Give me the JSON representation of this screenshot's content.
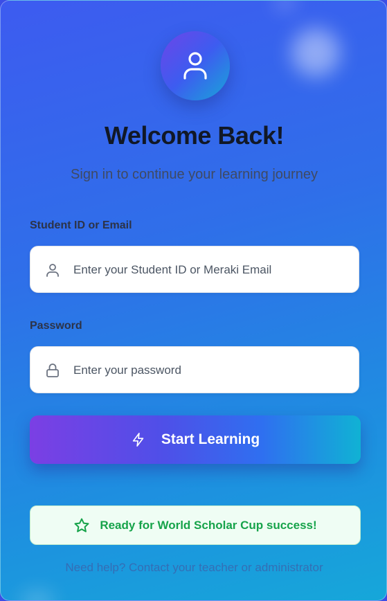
{
  "header": {
    "avatar_icon": "user-icon",
    "title": "Welcome Back!",
    "subtitle": "Sign in to continue your learning journey"
  },
  "form": {
    "student_id": {
      "label": "Student ID or Email",
      "placeholder": "Enter your Student ID or Meraki Email",
      "value": "",
      "icon": "user-icon"
    },
    "password": {
      "label": "Password",
      "placeholder": "Enter your password",
      "value": "",
      "icon": "lock-icon"
    },
    "submit": {
      "label": "Start Learning",
      "icon": "lightning-icon"
    }
  },
  "banner": {
    "text": "Ready for World Scholar Cup success!",
    "icon": "star-icon"
  },
  "footer": {
    "help_text": "Need help? Contact your teacher or administrator"
  },
  "colors": {
    "background_start": "#3d5bf0",
    "background_end": "#16a7d9",
    "button_start": "#7b3fe4",
    "button_end": "#10b2d4",
    "banner_bg": "#effdf4",
    "banner_text": "#16a34a",
    "title_text": "#111827"
  }
}
